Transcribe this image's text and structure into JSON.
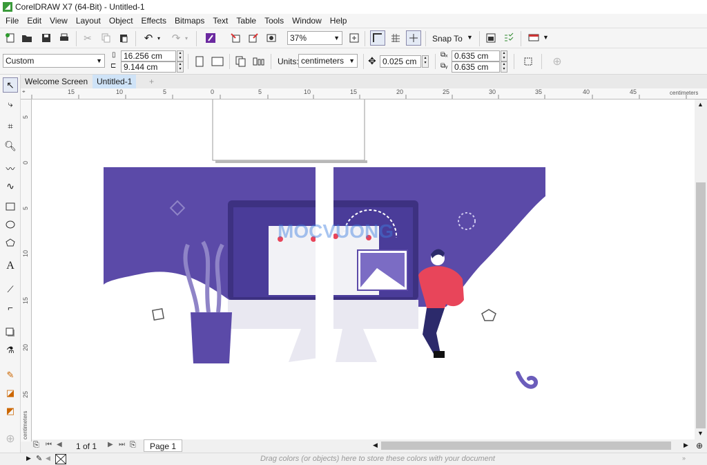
{
  "window": {
    "title": "CorelDRAW X7 (64-Bit) - Untitled-1"
  },
  "menu": [
    "File",
    "Edit",
    "View",
    "Layout",
    "Object",
    "Effects",
    "Bitmaps",
    "Text",
    "Table",
    "Tools",
    "Window",
    "Help"
  ],
  "toolbar": {
    "zoom_value": "37%",
    "snap_label": "Snap To"
  },
  "properties": {
    "page_preset": "Custom",
    "width": "16.256 cm",
    "height": "9.144 cm",
    "units_label": "Units:",
    "units_value": "centimeters",
    "nudge": "0.025 cm",
    "dup_x": "0.635 cm",
    "dup_y": "0.635 cm"
  },
  "tabs": [
    "Welcome Screen",
    "Untitled-1"
  ],
  "ruler": {
    "h_ticks": [
      "15",
      "10",
      "5",
      "0",
      "5",
      "10",
      "15",
      "20",
      "25",
      "30",
      "35",
      "40",
      "45"
    ],
    "h_unit": "centimeters",
    "v_ticks": [
      "5",
      "0",
      "5",
      "10",
      "15",
      "20",
      "25"
    ],
    "v_unit": "centimeters"
  },
  "pagenav": {
    "counter": "1 of 1",
    "page_tab": "Page 1"
  },
  "statusbar": {
    "hint": "Drag colors (or objects) here to store these colors with your document"
  },
  "artwork": {
    "watermark": "MOCVUONG",
    "colors": {
      "purple": "#5b4aa8",
      "purple_dark": "#3d3181",
      "red": "#e8455a",
      "light": "#e9e8f1",
      "navy": "#2c2a6b"
    }
  }
}
